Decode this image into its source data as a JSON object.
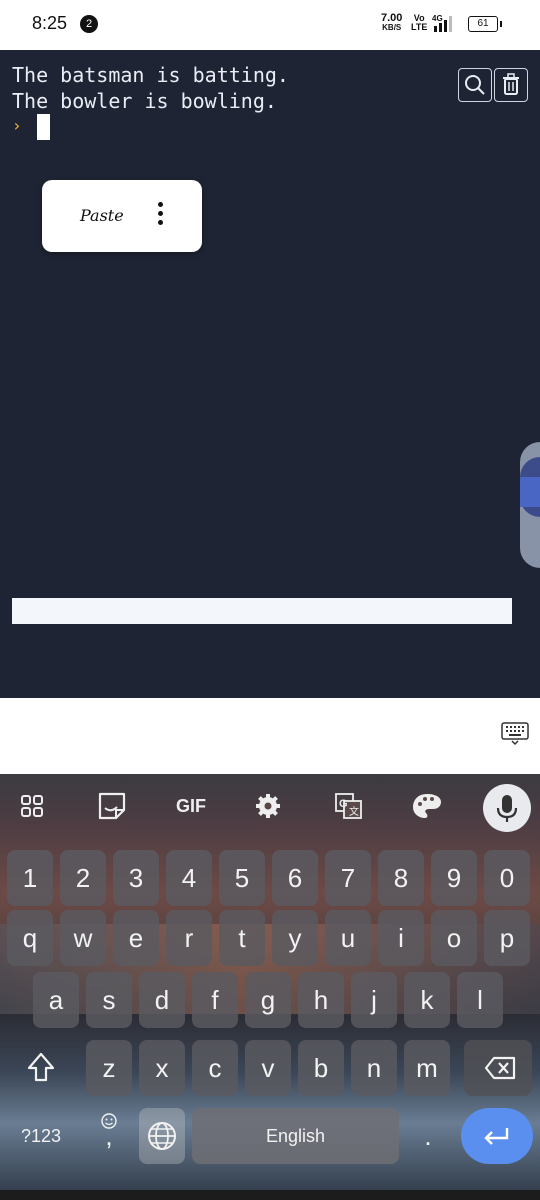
{
  "status": {
    "time": "8:25",
    "notification_count": "2",
    "net_speed_value": "7.00",
    "net_speed_unit": "KB/S",
    "volte_top": "Vo",
    "volte_bottom": "LTE",
    "network": "4G",
    "battery": "61"
  },
  "terminal": {
    "lines": [
      "The batsman is batting.",
      "The bowler is bowling."
    ],
    "prompt_glyph": "›",
    "search_icon": "search-icon",
    "trash_icon": "trash-icon"
  },
  "context_menu": {
    "paste_label": "Paste",
    "more_icon": "more-vertical-icon"
  },
  "keyboard": {
    "toolbar": {
      "apps_icon": "apps-grid-icon",
      "sticker_icon": "sticker-icon",
      "gif_label": "GIF",
      "settings_icon": "gear-icon",
      "translate_icon": "translate-icon",
      "theme_icon": "palette-icon",
      "mic_icon": "microphone-icon"
    },
    "number_row": [
      "1",
      "2",
      "3",
      "4",
      "5",
      "6",
      "7",
      "8",
      "9",
      "0"
    ],
    "row1": [
      "q",
      "w",
      "e",
      "r",
      "t",
      "y",
      "u",
      "i",
      "o",
      "p"
    ],
    "row2": [
      "a",
      "s",
      "d",
      "f",
      "g",
      "h",
      "j",
      "k",
      "l"
    ],
    "row3": [
      "z",
      "x",
      "c",
      "v",
      "b",
      "n",
      "m"
    ],
    "symbols_label": "?123",
    "comma_label": ",",
    "space_label": "English",
    "period_label": ".",
    "accent_color": "#5a8ff0"
  }
}
